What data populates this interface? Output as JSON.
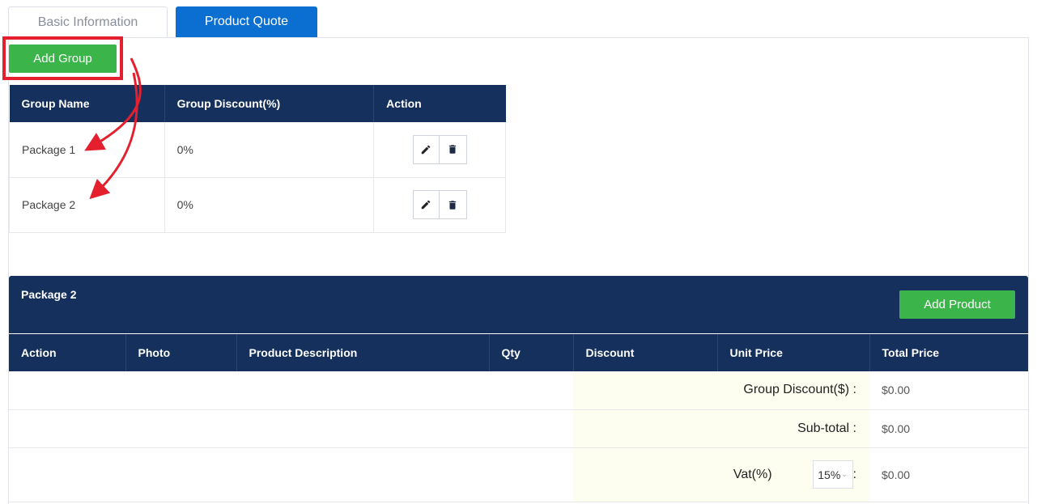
{
  "tabs": [
    {
      "label": "Basic Information",
      "active": false
    },
    {
      "label": "Product Quote",
      "active": true
    }
  ],
  "add_group_label": "Add Group",
  "group_table": {
    "headers": [
      "Group Name",
      "Group Discount(%)",
      "Action"
    ],
    "rows": [
      {
        "name": "Package 1",
        "discount": "0%"
      },
      {
        "name": "Package 2",
        "discount": "0%"
      }
    ]
  },
  "package": {
    "title": "Package 2",
    "add_product_label": "Add Product",
    "headers": [
      "Action",
      "Photo",
      "Product Description",
      "Qty",
      "Discount",
      "Unit Price",
      "Total Price"
    ],
    "summary": {
      "group_discount_label": "Group Discount($) :",
      "group_discount_value": "$0.00",
      "subtotal_label": "Sub-total :",
      "subtotal_value": "$0.00",
      "vat_label": "Vat(%)",
      "vat_selected": "15%",
      "vat_colon": ":",
      "vat_value": "$0.00"
    }
  },
  "colors": {
    "header_navy": "#15305c",
    "primary_blue": "#0a6fd1",
    "action_green": "#3bb54a",
    "annotation_red": "#e5202e"
  }
}
